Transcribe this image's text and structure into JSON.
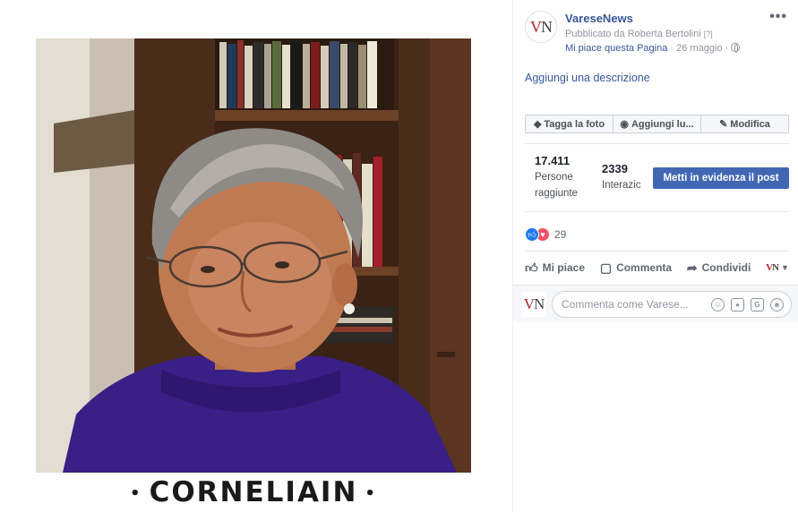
{
  "photo": {
    "caption_dot_left": "•",
    "caption_text": "CORNELIAIN",
    "caption_dot_right": "•"
  },
  "post": {
    "page_name": "VareseNews",
    "page_logo": {
      "v": "V",
      "n": "N"
    },
    "published_by": "Pubblicato da Roberta Bertolini",
    "published_help": "[?]",
    "like_page": "Mi piace questa Pagina",
    "separator": "·",
    "date": "26 maggio",
    "more": "•••",
    "add_description": "Aggiungi una descrizione"
  },
  "photo_toolbar": {
    "tag": "Tagga la foto",
    "add_location": "Aggiungi lu...",
    "edit": "Modifica"
  },
  "stats": {
    "reach_value": "17.411",
    "reach_label_1": "Persone",
    "reach_label_2": "raggiunte",
    "engagement_value": "2339",
    "engagement_label": "Interazic",
    "boost_label": "Metti in evidenza il post"
  },
  "reactions": {
    "count": "29",
    "like_icon": "thumbs-up",
    "love_icon": "heart"
  },
  "actions": {
    "like": "Mi piace",
    "comment": "Commenta",
    "share": "Condividi"
  },
  "comment": {
    "placeholder": "Commenta come Varese..."
  },
  "colors": {
    "link": "#365899",
    "boost": "#4267b2",
    "like": "#2078f4",
    "love": "#f25268",
    "brand_red": "#b22330"
  }
}
